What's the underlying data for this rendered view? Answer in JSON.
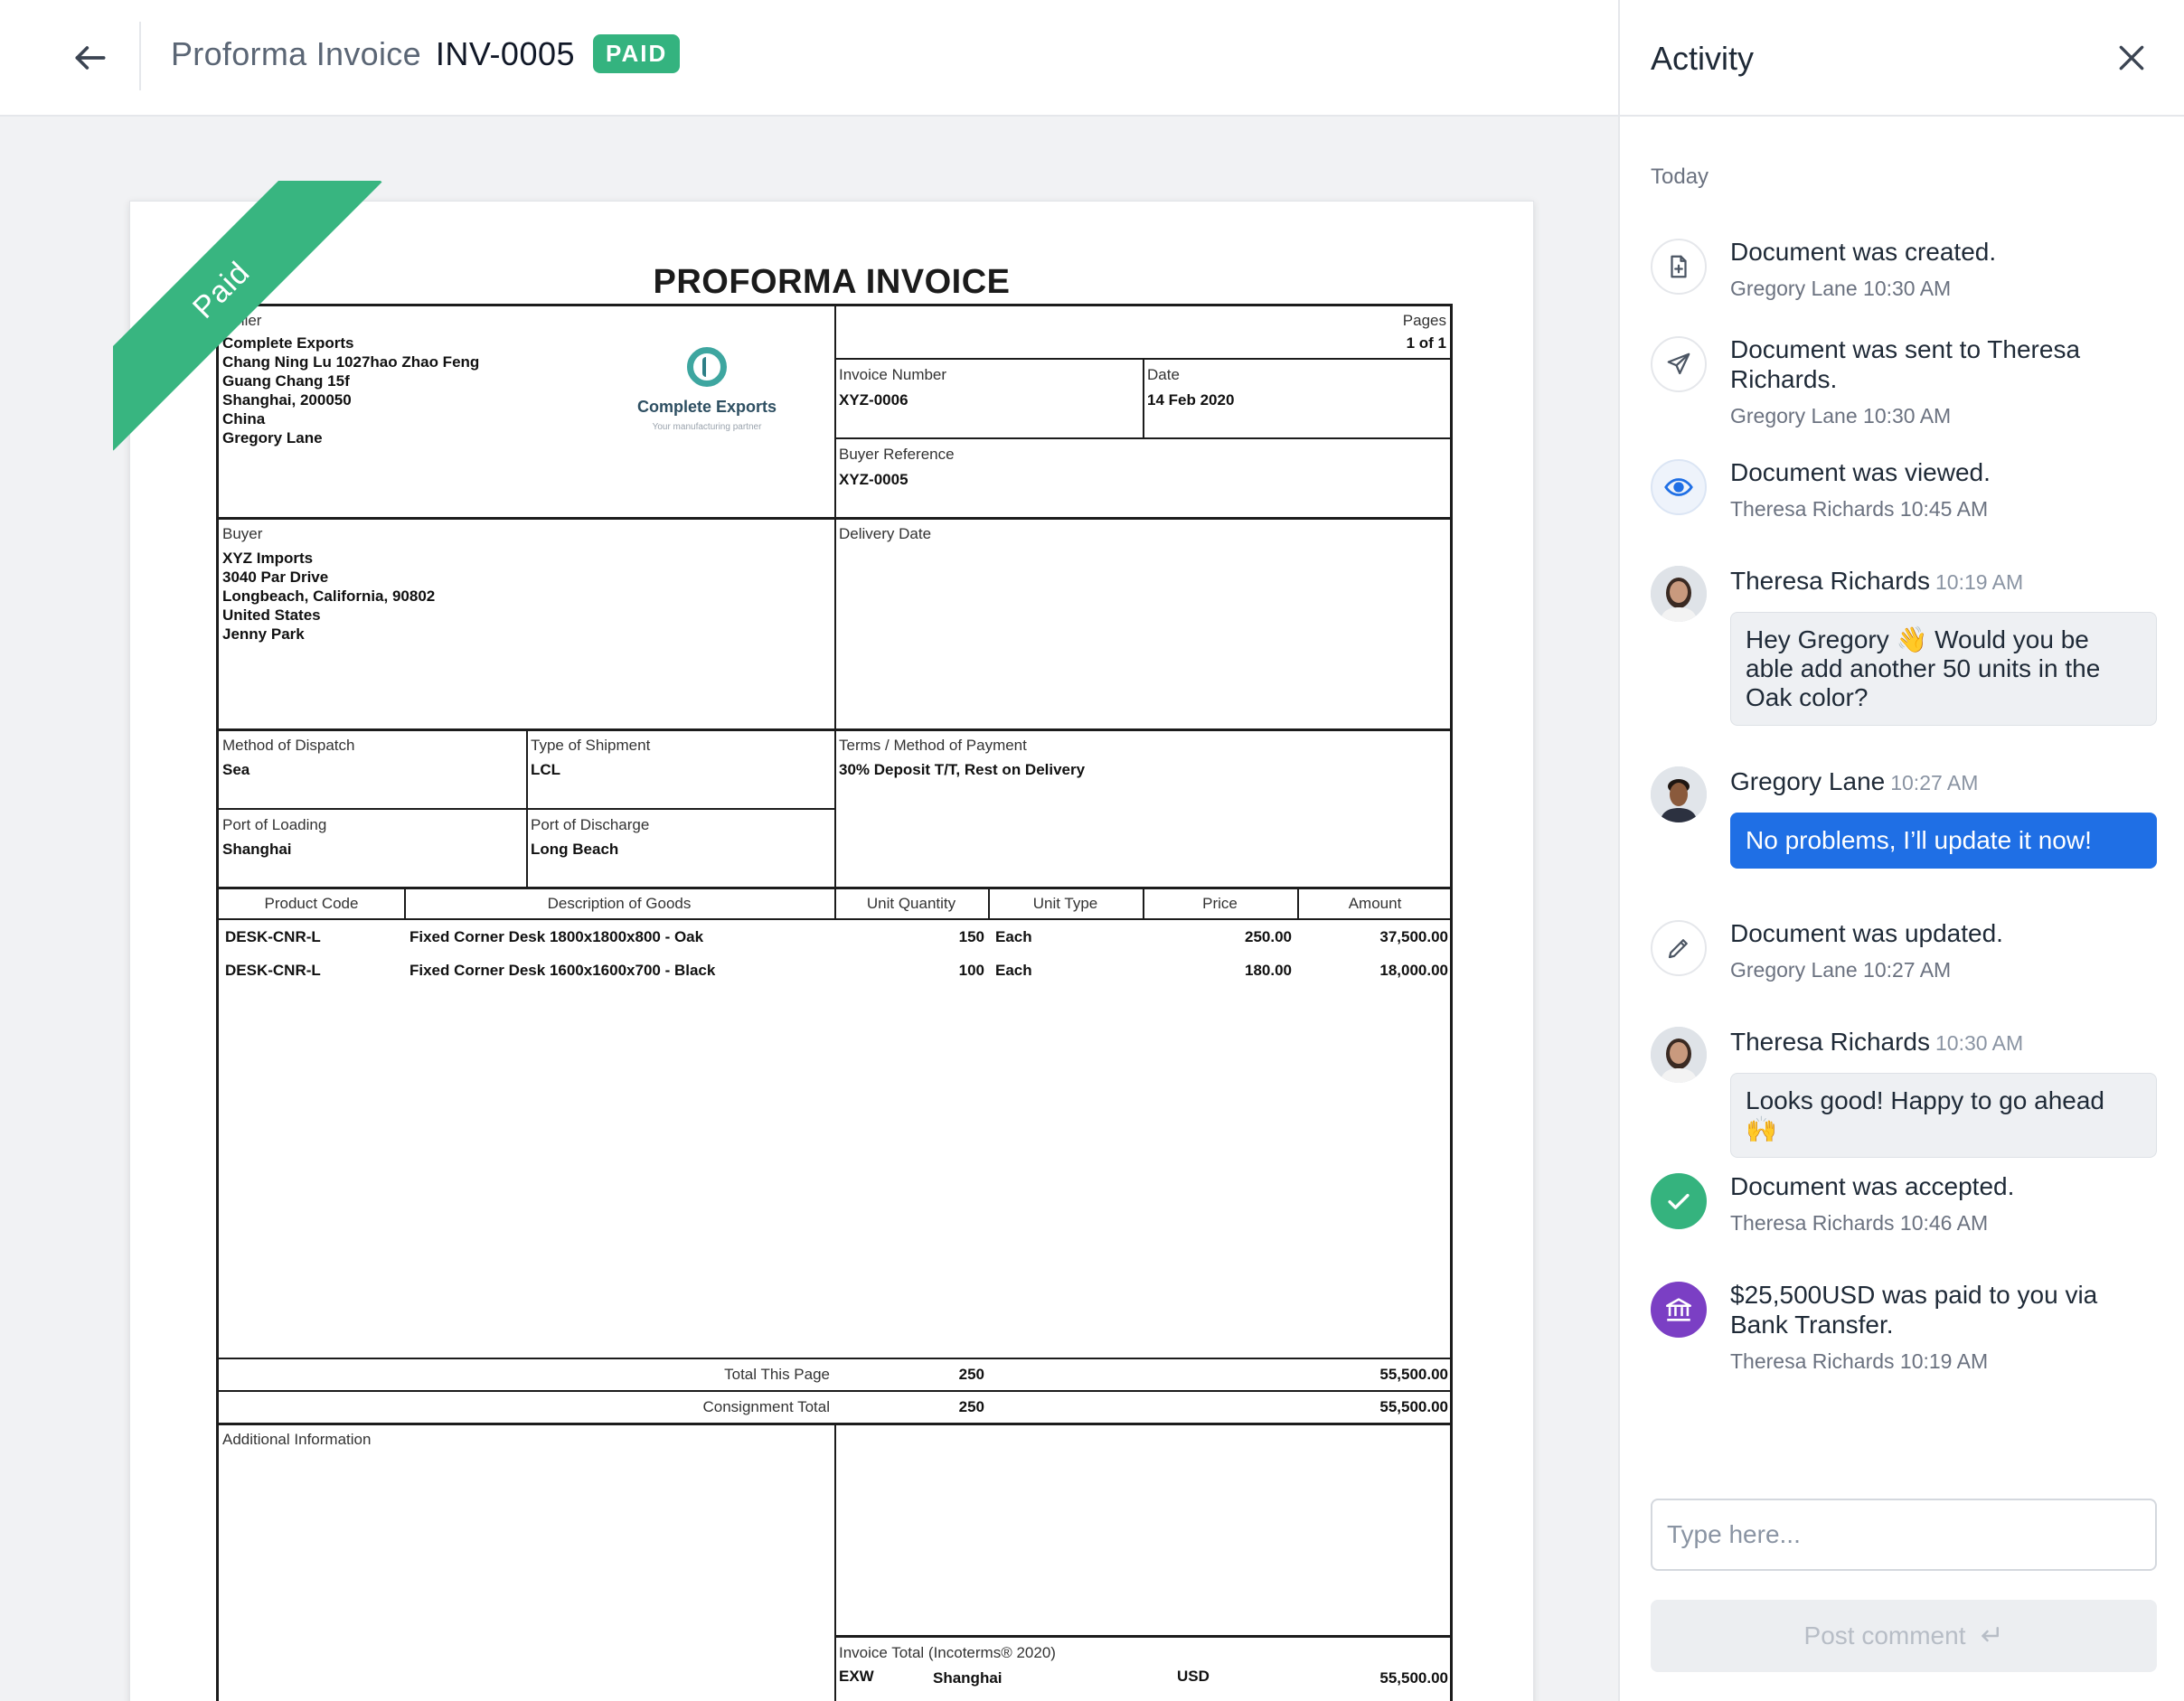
{
  "header": {
    "title_label": "Proforma Invoice",
    "invoice_number": "INV-0005",
    "status_badge": "PAID"
  },
  "document": {
    "ribbon": "Paid",
    "title": "PROFORMA INVOICE",
    "seller": {
      "label": "Seller",
      "lines": [
        "Complete Exports",
        "Chang Ning Lu 1027hao Zhao Feng",
        "Guang Chang 15f",
        "Shanghai,  200050",
        "China",
        "Gregory Lane"
      ]
    },
    "logo": {
      "name": "Complete Exports",
      "tagline": "Your manufacturing partner"
    },
    "pages": {
      "label": "Pages",
      "value": "1 of 1"
    },
    "invoice_number": {
      "label": "Invoice Number",
      "value": "XYZ-0006"
    },
    "date": {
      "label": "Date",
      "value": "14 Feb 2020"
    },
    "buyer_reference": {
      "label": "Buyer Reference",
      "value": "XYZ-0005"
    },
    "buyer": {
      "label": "Buyer",
      "lines": [
        "XYZ Imports",
        "3040  Par Drive",
        "Longbeach, California, 90802",
        "United States",
        "Jenny Park"
      ]
    },
    "delivery_date": {
      "label": "Delivery Date"
    },
    "method_of_dispatch": {
      "label": "Method of Dispatch",
      "value": "Sea"
    },
    "type_of_shipment": {
      "label": "Type of Shipment",
      "value": "LCL"
    },
    "terms": {
      "label": "Terms / Method of Payment",
      "value": "30% Deposit T/T, Rest on Delivery"
    },
    "port_of_loading": {
      "label": "Port of Loading",
      "value": "Shanghai"
    },
    "port_of_discharge": {
      "label": "Port of Discharge",
      "value": "Long Beach"
    },
    "table": {
      "headers": [
        "Product Code",
        "Description of Goods",
        "Unit Quantity",
        "Unit Type",
        "Price",
        "Amount"
      ],
      "rows": [
        {
          "code": "DESK-CNR-L",
          "description": "Fixed Corner Desk 1800x1800x800 - Oak",
          "quantity": "150",
          "unit": "Each",
          "price": "250.00",
          "amount": "37,500.00"
        },
        {
          "code": "DESK-CNR-L",
          "description": "Fixed Corner Desk 1600x1600x700 - Black",
          "quantity": "100",
          "unit": "Each",
          "price": "180.00",
          "amount": "18,000.00"
        }
      ]
    },
    "total_this_page": {
      "label": "Total This Page",
      "quantity": "250",
      "amount": "55,500.00"
    },
    "consignment_total": {
      "label": "Consignment Total",
      "quantity": "250",
      "amount": "55,500.00"
    },
    "additional_info": {
      "label": "Additional Information"
    },
    "invoice_total": {
      "label": "Invoice Total (Incoterms® 2020)",
      "incoterm": "EXW",
      "place": "Shanghai",
      "currency": "USD",
      "amount": "55,500.00"
    }
  },
  "activity": {
    "title": "Activity",
    "day_label": "Today",
    "events": [
      {
        "type": "created",
        "title": "Document was created.",
        "who": "Gregory Lane",
        "time": "10:30 AM"
      },
      {
        "type": "sent",
        "title": "Document was sent to Theresa Richards.",
        "who": "Gregory Lane",
        "time": "10:30 AM"
      },
      {
        "type": "viewed",
        "title": "Document was viewed.",
        "who": "Theresa Richards",
        "time": "10:45 AM"
      },
      {
        "type": "comment",
        "who": "Theresa Richards",
        "time": "10:19 AM",
        "text": "Hey Gregory 👋 Would you be able add another 50 units in the Oak color?"
      },
      {
        "type": "comment-mine",
        "who": "Gregory Lane",
        "time": "10:27 AM",
        "text": "No problems, I’ll update it now!"
      },
      {
        "type": "updated",
        "title": "Document was updated.",
        "who": "Gregory Lane",
        "time": "10:27 AM"
      },
      {
        "type": "comment",
        "who": "Theresa Richards",
        "time": "10:30 AM",
        "text": "Looks good! Happy to go ahead 🙌"
      },
      {
        "type": "accepted",
        "title": "Document was accepted.",
        "who": "Theresa Richards",
        "time": "10:46 AM"
      },
      {
        "type": "paid",
        "title": "$25,500USD was paid to you via Bank Transfer.",
        "who": "Theresa Richards",
        "time": "10:19 AM"
      }
    ],
    "comment_placeholder": "Type here...",
    "post_button": "Post comment"
  },
  "colors": {
    "paid_green": "#34b37f",
    "accent_blue": "#1f6fe5",
    "bank_purple": "#7b3fc4"
  }
}
